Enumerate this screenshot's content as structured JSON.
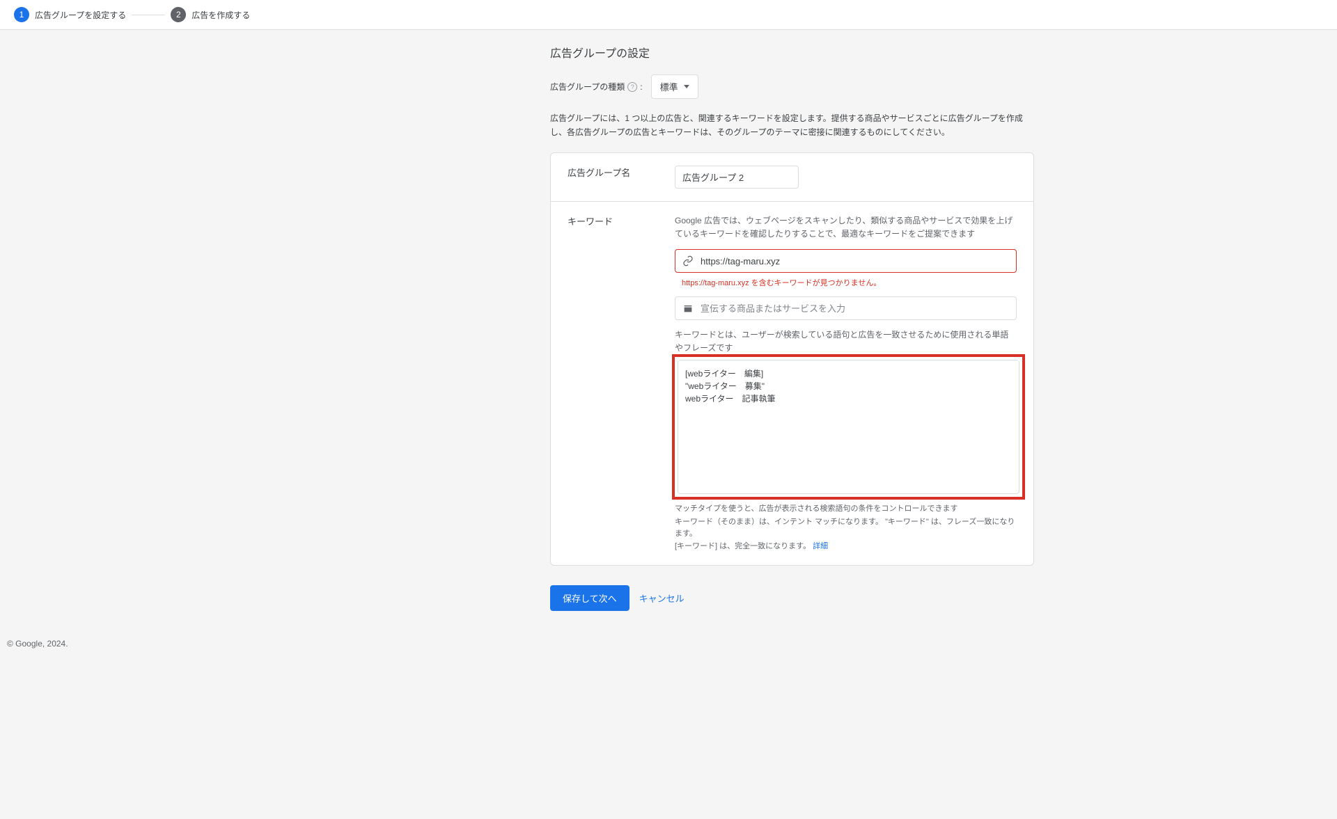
{
  "stepper": {
    "step1": {
      "num": "1",
      "label": "広告グループを設定する"
    },
    "step2": {
      "num": "2",
      "label": "広告を作成する"
    }
  },
  "page_title": "広告グループの設定",
  "type_label": "広告グループの種類",
  "type_value": "標準",
  "intro": "広告グループには、1 つ以上の広告と、関連するキーワードを設定します。提供する商品やサービスごとに広告グループを作成し、各広告グループの広告とキーワードは、そのグループのテーマに密接に関連するものにしてください。",
  "group_name_label": "広告グループ名",
  "group_name_value": "広告グループ 2",
  "keyword_label": "キーワード",
  "keyword_intro": "Google 広告では、ウェブページをスキャンしたり、類似する商品やサービスで効果を上げているキーワードを確認したりすることで、最適なキーワードをご提案できます",
  "url_value": "https://tag-maru.xyz",
  "url_error": "https://tag-maru.xyz を含むキーワードが見つかりません。",
  "product_placeholder": "宣伝する商品またはサービスを入力",
  "kw_desc": "キーワードとは、ユーザーが検索している語句と広告を一致させるために使用される単語やフレーズです",
  "kw_textarea": "[webライター　編集]\n\"webライター　募集\"\nwebライター　記事執筆",
  "match_note": "マッチタイプを使うと、広告が表示される検索語句の条件をコントロールできます",
  "kw_help_line1": "キーワード（そのまま）は、インテント マッチになります。 \"キーワード\" は、フレーズ一致になります。",
  "kw_help_line2": "[キーワード] は、完全一致になります。 ",
  "kw_help_link": "詳細",
  "primary_btn": "保存して次へ",
  "cancel": "キャンセル",
  "footer": "© Google, 2024."
}
